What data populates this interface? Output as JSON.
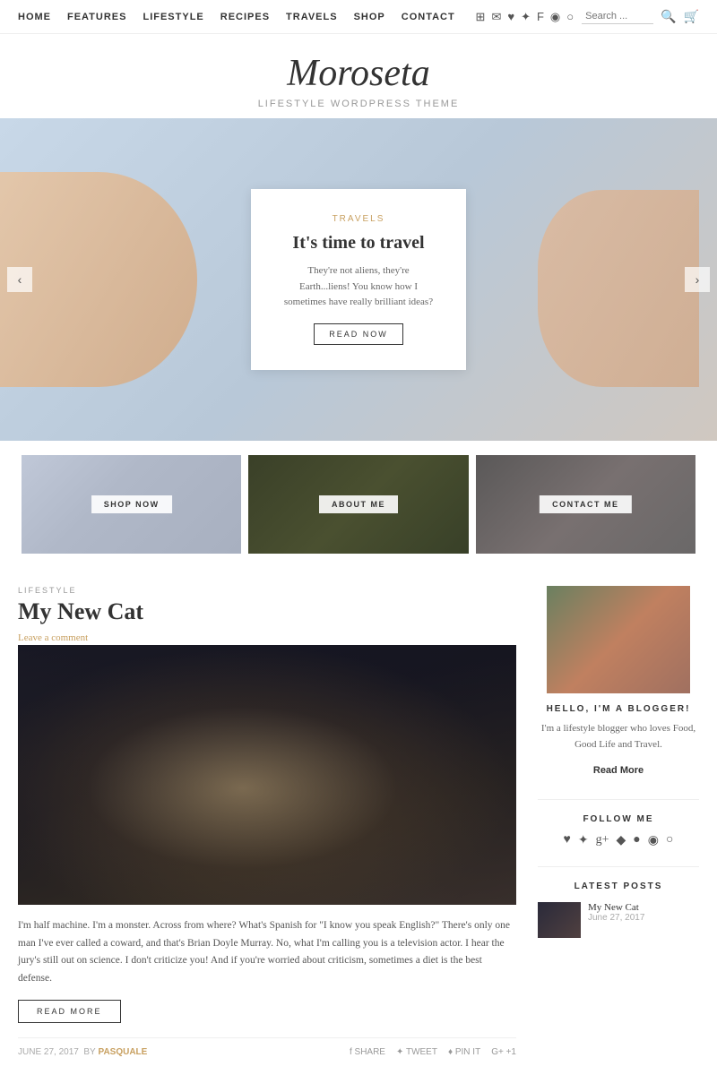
{
  "nav": {
    "links": [
      {
        "label": "HOME",
        "id": "home"
      },
      {
        "label": "FEATURES",
        "id": "features"
      },
      {
        "label": "LIFESTYLE",
        "id": "lifestyle"
      },
      {
        "label": "RECIPES",
        "id": "recipes"
      },
      {
        "label": "TRAVELS",
        "id": "travels"
      },
      {
        "label": "SHOP",
        "id": "shop"
      },
      {
        "label": "CONTACT",
        "id": "contact"
      }
    ],
    "search_placeholder": "Search ...",
    "icons": [
      "rss",
      "email",
      "heart",
      "twitter",
      "facebook",
      "instagram",
      "circle"
    ]
  },
  "site": {
    "title": "Moroseta",
    "tagline": "Lifestyle Wordpress Theme"
  },
  "hero": {
    "category": "TRAVELS",
    "title": "It's time to travel",
    "excerpt": "They're not aliens, they're Earth...liens! You know how I sometimes have really brilliant ideas?",
    "button": "READ NOW"
  },
  "thumbs": [
    {
      "label": "SHOP NOW",
      "id": "shop-thumb"
    },
    {
      "label": "ABOUT ME",
      "id": "about-thumb"
    },
    {
      "label": "CONTACT ME",
      "id": "contact-thumb"
    }
  ],
  "post": {
    "category": "LIFESTYLE",
    "title": "My New Cat",
    "comment_link": "Leave a comment",
    "excerpt": "I'm half machine. I'm a monster. Across from where? What's Spanish for \"I know you speak English?\" There's only one man I've ever called a coward, and that's Brian Doyle Murray. No, what I'm calling you is a television actor. I hear the jury's still out on science. I don't criticize you! And if you're worried about criticism, sometimes a diet is the best defense.",
    "read_more": "READ MORE",
    "date": "JUNE 27, 2017",
    "by": "BY",
    "author": "PASQUALE",
    "share": [
      {
        "label": "f SHARE"
      },
      {
        "label": "✦ TWEET"
      },
      {
        "label": "♦ PIN IT"
      },
      {
        "label": "G+ +1"
      }
    ]
  },
  "sidebar": {
    "hello": "HELLO, I'M A BLOGGER!",
    "bio": "I'm a lifestyle blogger who loves Food, Good Life and Travel.",
    "read_more": "Read More",
    "follow_title": "FOLLOW ME",
    "follow_icons": [
      "♥",
      "✦",
      "g+",
      "♦",
      "●",
      "○",
      "◉"
    ],
    "latest_title": "LATEST POSTS",
    "latest_posts": [
      {
        "title": "My New Cat",
        "date": "June 27, 2017"
      }
    ]
  }
}
